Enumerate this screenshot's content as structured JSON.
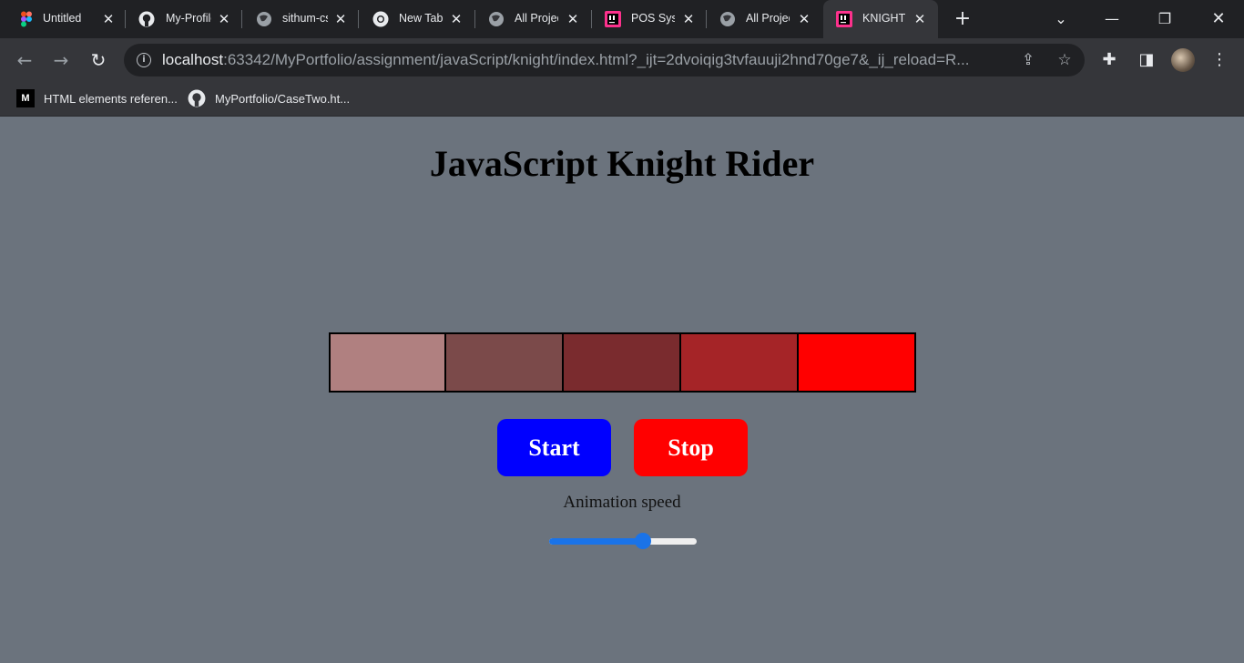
{
  "browser": {
    "tabs": [
      {
        "title": "Untitled",
        "icon": "figma-icon"
      },
      {
        "title": "My-Profile",
        "icon": "github-icon"
      },
      {
        "title": "sithum-cs",
        "icon": "globe-icon"
      },
      {
        "title": "New Tab",
        "icon": "chrome-icon"
      },
      {
        "title": "All Projects",
        "icon": "globe-icon"
      },
      {
        "title": "POS System",
        "icon": "intellij-icon"
      },
      {
        "title": "All Projects",
        "icon": "globe-icon"
      },
      {
        "title": "KNIGHT",
        "icon": "intellij-icon",
        "active": true
      }
    ],
    "url_host": "localhost",
    "url_rest": ":63342/MyPortfolio/assignment/javaScript/knight/index.html?_ijt=2dvoiqig3tvfauuji2hnd70ge7&_ij_reload=R...",
    "bookmarks": [
      {
        "label": "HTML elements referen...",
        "icon": "mdn-icon"
      },
      {
        "label": "MyPortfolio/CaseTwo.ht...",
        "icon": "github-icon"
      }
    ]
  },
  "page": {
    "title": "JavaScript Knight Rider",
    "box_colors": [
      "#b08080",
      "#7b4a4a",
      "#7a2b2e",
      "#a52427",
      "#ff0000"
    ],
    "start_label": "Start",
    "start_color": "#0000ff",
    "stop_label": "Stop",
    "stop_color": "#ff0000",
    "speed_label": "Animation speed",
    "speed_value": 0.65
  }
}
